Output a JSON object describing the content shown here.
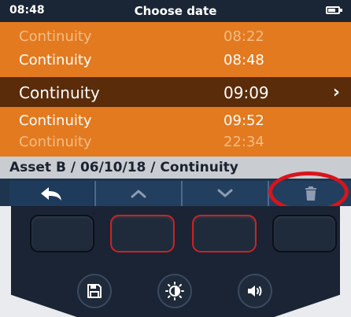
{
  "statusbar": {
    "time": "08:48",
    "title": "Choose date"
  },
  "list": {
    "items": [
      {
        "name": "Continuity",
        "time": "08:22"
      },
      {
        "name": "Continuity",
        "time": "08:48"
      },
      {
        "name": "Continuity",
        "time": "09:09"
      },
      {
        "name": "Continuity",
        "time": "09:52"
      },
      {
        "name": "Continuity",
        "time": "22:34"
      }
    ],
    "selected_chevron": "›"
  },
  "breadcrumb": {
    "text": "Asset B / 06/10/18 / Continuity"
  },
  "softkeys": {
    "icons": [
      "back-arrow-icon",
      "chevron-up-icon",
      "chevron-down-icon",
      "trash-icon"
    ]
  },
  "device": {
    "round_icons": [
      "save-icon",
      "brightness-icon",
      "volume-icon"
    ]
  },
  "colors": {
    "screen_orange": "#e37a1f",
    "selected_row": "#5a2c0a",
    "statusbar": "#1a2535",
    "softkey_bar": "#1e3550",
    "highlight_red": "#d8141b"
  }
}
